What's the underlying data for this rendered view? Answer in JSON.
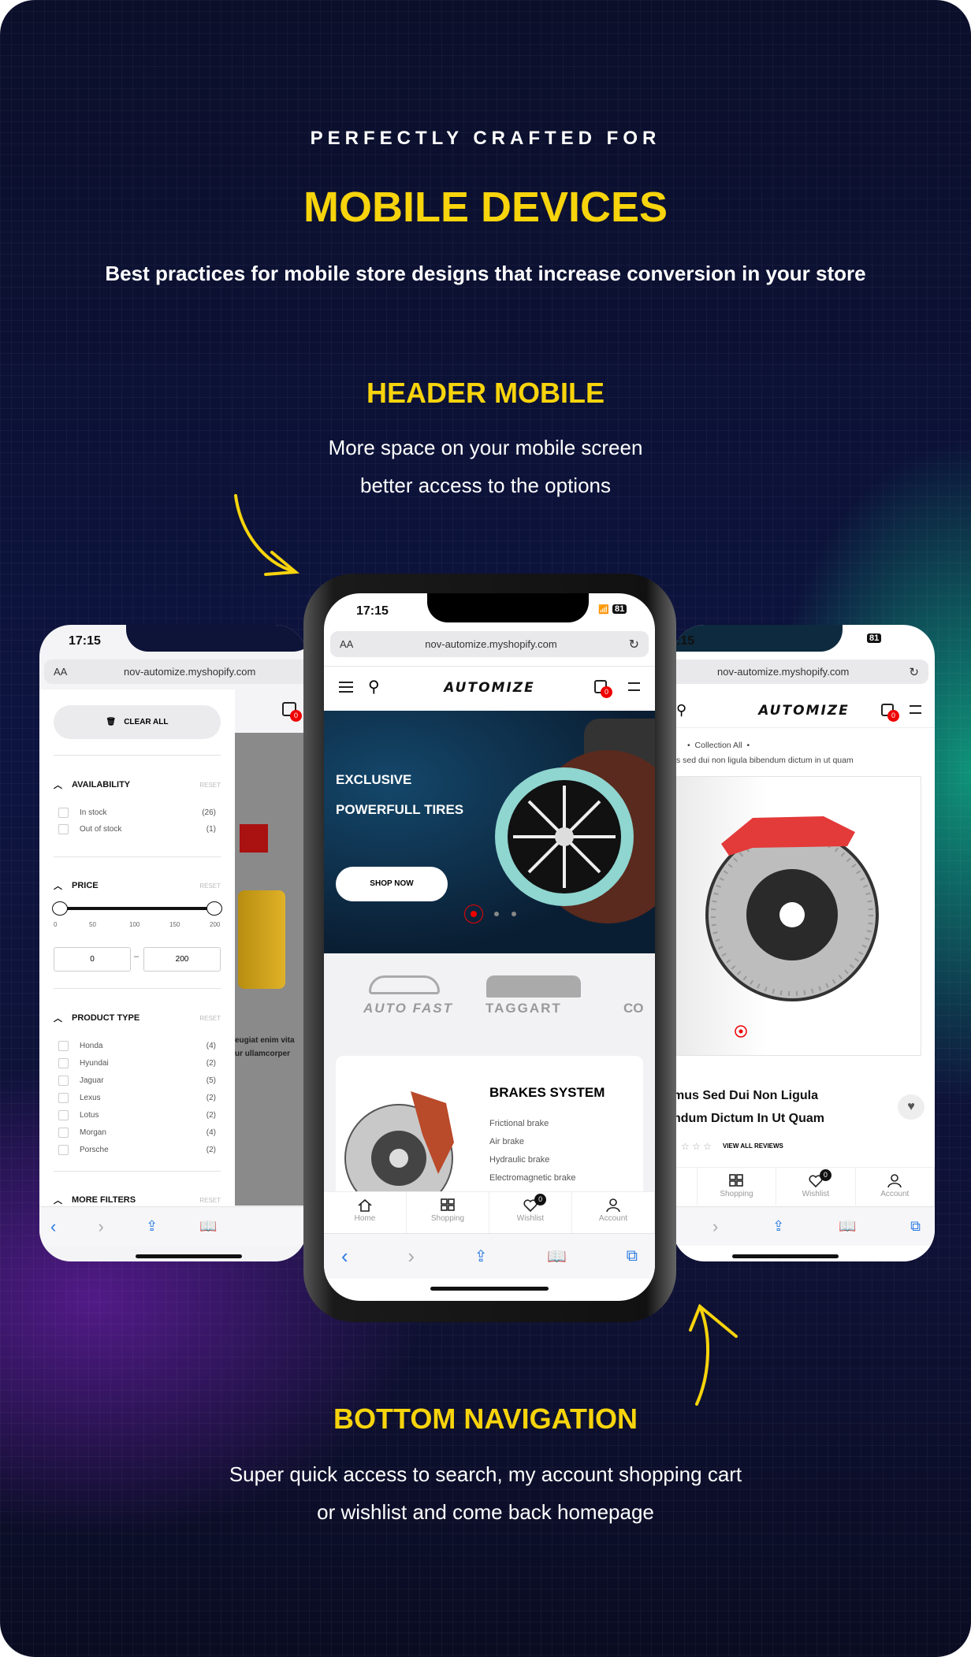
{
  "hero": {
    "kicker": "PERFECTLY CRAFTED FOR",
    "title": "MOBILE DEVICES",
    "subtitle": "Best practices for mobile store designs that increase conversion in your store"
  },
  "section_header": {
    "title": "HEADER MOBILE",
    "lines": [
      "More space on your mobile screen",
      "better access to the options"
    ]
  },
  "section_bottom": {
    "title": "BOTTOM NAVIGATION",
    "lines": [
      "Super quick access to search, my account shopping cart",
      "or wishlist and come back homepage"
    ]
  },
  "colors": {
    "accent": "#f7d40c",
    "badge": "#e00000",
    "background": "#0d1440"
  },
  "browser": {
    "time": "17:15",
    "battery": "81",
    "aa": "AA",
    "url": "nov-automize.myshopify.com"
  },
  "store": {
    "logo": "AUTOMIZE",
    "cart_count": "0",
    "wishlist_count": "0"
  },
  "center_phone": {
    "banner": {
      "line1": "EXCLUSIVE",
      "line2": "POWERFULL TIRES",
      "cta": "SHOP NOW",
      "slides": 3,
      "active_slide": 1
    },
    "brands": [
      "AUTO FAST",
      "TAGGART",
      "CO"
    ],
    "category": {
      "title": "BRAKES SYSTEM",
      "items": [
        "Frictional brake",
        "Air brake",
        "Hydraulic brake",
        "Electromagnetic brake"
      ]
    },
    "bottom_nav": [
      {
        "label": "Home",
        "icon": "home-icon"
      },
      {
        "label": "Shopping",
        "icon": "grid-icon"
      },
      {
        "label": "Wishlist",
        "icon": "heart-icon"
      },
      {
        "label": "Account",
        "icon": "user-icon"
      }
    ]
  },
  "left_phone": {
    "clear_all": "CLEAR ALL",
    "reset": "RESET",
    "availability": {
      "title": "AVAILABILITY",
      "items": [
        {
          "name": "In stock",
          "count": "(26)"
        },
        {
          "name": "Out of stock",
          "count": "(1)"
        }
      ]
    },
    "price": {
      "title": "PRICE",
      "ticks": [
        "0",
        "50",
        "100",
        "150",
        "200"
      ],
      "min": "0",
      "max": "200",
      "separator": "–"
    },
    "product_type": {
      "title": "PRODUCT TYPE",
      "items": [
        {
          "name": "Honda",
          "count": "(4)"
        },
        {
          "name": "Hyundai",
          "count": "(2)"
        },
        {
          "name": "Jaguar",
          "count": "(5)"
        },
        {
          "name": "Lexus",
          "count": "(2)"
        },
        {
          "name": "Lotus",
          "count": "(2)"
        },
        {
          "name": "Morgan",
          "count": "(4)"
        },
        {
          "name": "Porsche",
          "count": "(2)"
        }
      ]
    },
    "more_filters": "MORE FILTERS",
    "behind_text": [
      "eugiat enim vita",
      "ur ullamcorper"
    ]
  },
  "right_phone": {
    "breadcrumb": "Collection All",
    "breadcrumb_title": "s sed dui non ligula bibendum dictum in ut quam",
    "product_title_1": "mus Sed Dui Non Ligula",
    "product_title_2": "ndum Dictum In Ut Quam",
    "reviews": "VIEW ALL REVIEWS",
    "bottom_nav": [
      "Shopping",
      "Wishlist",
      "Account"
    ]
  }
}
